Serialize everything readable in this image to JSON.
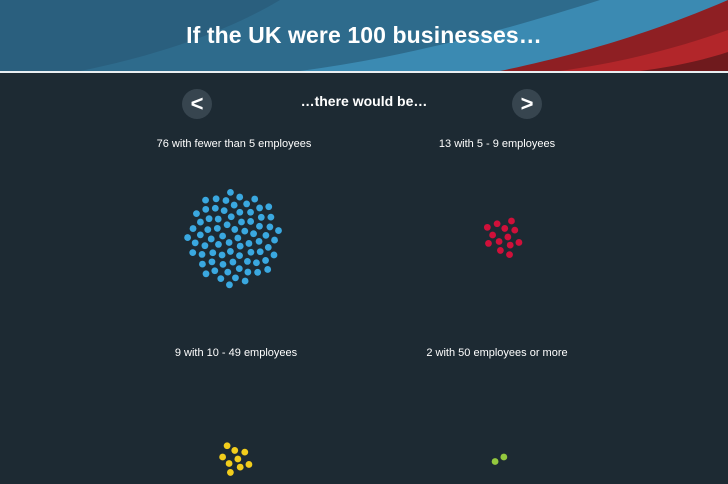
{
  "header": {
    "title": "If the UK were 100 businesses…"
  },
  "nav": {
    "prev_label": "<",
    "next_label": ">",
    "subtitle": "…there would be…"
  },
  "groups": [
    {
      "label": "76 with fewer than 5 employees",
      "count": 76,
      "color": "#3aa8e0"
    },
    {
      "label": "13 with 5 - 9 employees",
      "count": 13,
      "color": "#d0103a"
    },
    {
      "label": "9 with 10 - 49 employees",
      "count": 9,
      "color": "#f2cd1c"
    },
    {
      "label": "2 with 50 employees or more",
      "count": 2,
      "color": "#93c83e"
    }
  ],
  "colors": {
    "background": "#1d2a33",
    "banner_blue": "#3d8bb3",
    "banner_red": "#8e1f23"
  }
}
